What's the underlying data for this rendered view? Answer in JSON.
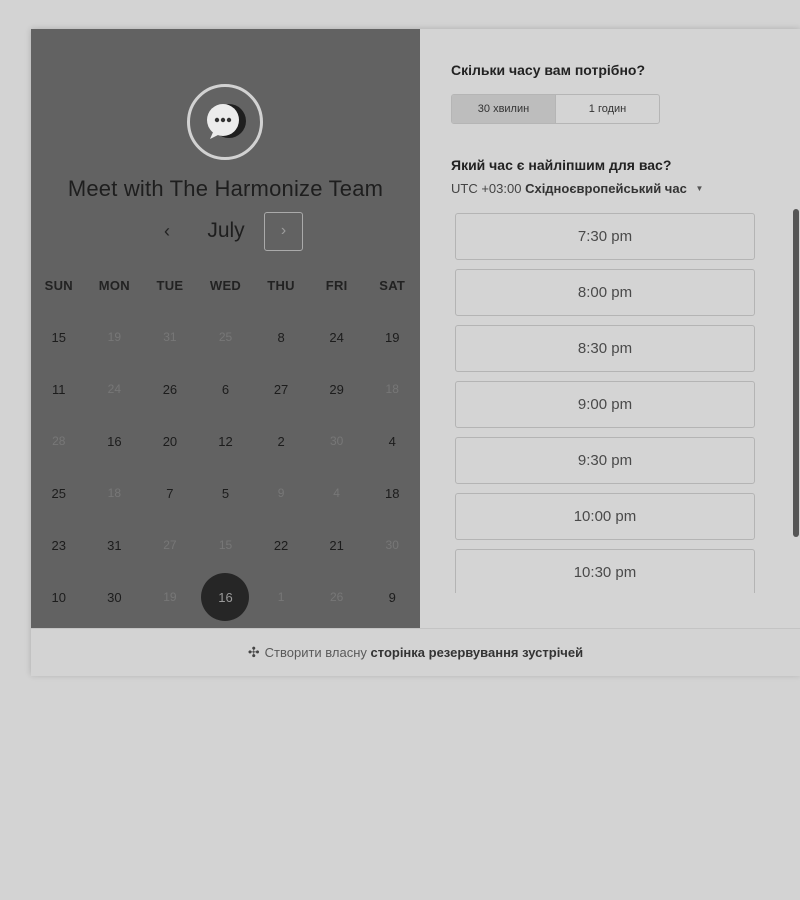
{
  "calendar": {
    "title": "Meet with The Harmonize Team",
    "month": "July",
    "prev_icon": "‹",
    "next_icon": "›",
    "weekdays": [
      "SUN",
      "MON",
      "TUE",
      "WED",
      "THU",
      "FRI",
      "SAT"
    ],
    "days": [
      {
        "label": "15",
        "dim": false
      },
      {
        "label": "19",
        "dim": true
      },
      {
        "label": "31",
        "dim": true
      },
      {
        "label": "25",
        "dim": true
      },
      {
        "label": "8",
        "dim": false
      },
      {
        "label": "24",
        "dim": false
      },
      {
        "label": "19",
        "dim": false
      },
      {
        "label": "11",
        "dim": false
      },
      {
        "label": "24",
        "dim": true
      },
      {
        "label": "26",
        "dim": false
      },
      {
        "label": "6",
        "dim": false
      },
      {
        "label": "27",
        "dim": false
      },
      {
        "label": "29",
        "dim": false
      },
      {
        "label": "18",
        "dim": true
      },
      {
        "label": "28",
        "dim": true
      },
      {
        "label": "16",
        "dim": false
      },
      {
        "label": "20",
        "dim": false
      },
      {
        "label": "12",
        "dim": false
      },
      {
        "label": "2",
        "dim": false
      },
      {
        "label": "30",
        "dim": true
      },
      {
        "label": "4",
        "dim": false
      },
      {
        "label": "25",
        "dim": false
      },
      {
        "label": "18",
        "dim": true
      },
      {
        "label": "7",
        "dim": false
      },
      {
        "label": "5",
        "dim": false
      },
      {
        "label": "9",
        "dim": true
      },
      {
        "label": "4",
        "dim": true
      },
      {
        "label": "18",
        "dim": false
      },
      {
        "label": "23",
        "dim": false
      },
      {
        "label": "31",
        "dim": false
      },
      {
        "label": "27",
        "dim": true
      },
      {
        "label": "15",
        "dim": true
      },
      {
        "label": "22",
        "dim": false
      },
      {
        "label": "21",
        "dim": false
      },
      {
        "label": "30",
        "dim": true
      },
      {
        "label": "10",
        "dim": false
      },
      {
        "label": "30",
        "dim": false
      },
      {
        "label": "19",
        "dim": true
      },
      {
        "label": "16",
        "dim": false,
        "selected": true
      },
      {
        "label": "1",
        "dim": true
      },
      {
        "label": "26",
        "dim": true
      },
      {
        "label": "9",
        "dim": false
      }
    ]
  },
  "booking": {
    "duration_question": "Скільки часу вам потрібно?",
    "durations": [
      {
        "label": "30 хвилин",
        "active": true
      },
      {
        "label": "1 годин",
        "active": false
      }
    ],
    "time_question": "Який час є найліпшим для вас?",
    "timezone": {
      "offset": "UTC +03:00",
      "name": "Східноєвропейський час"
    },
    "slots": [
      "7:30 pm",
      "8:00 pm",
      "8:30 pm",
      "9:00 pm",
      "9:30 pm",
      "10:00 pm",
      "10:30 pm"
    ]
  },
  "footer": {
    "icon": "sprocket-icon",
    "prefix": "Створити власну",
    "link": "сторінка резервування зустрічей"
  },
  "colors": {
    "calendar_bg": "#626262",
    "selected_day": "#262626",
    "panel_bg": "#d4d4d4"
  }
}
